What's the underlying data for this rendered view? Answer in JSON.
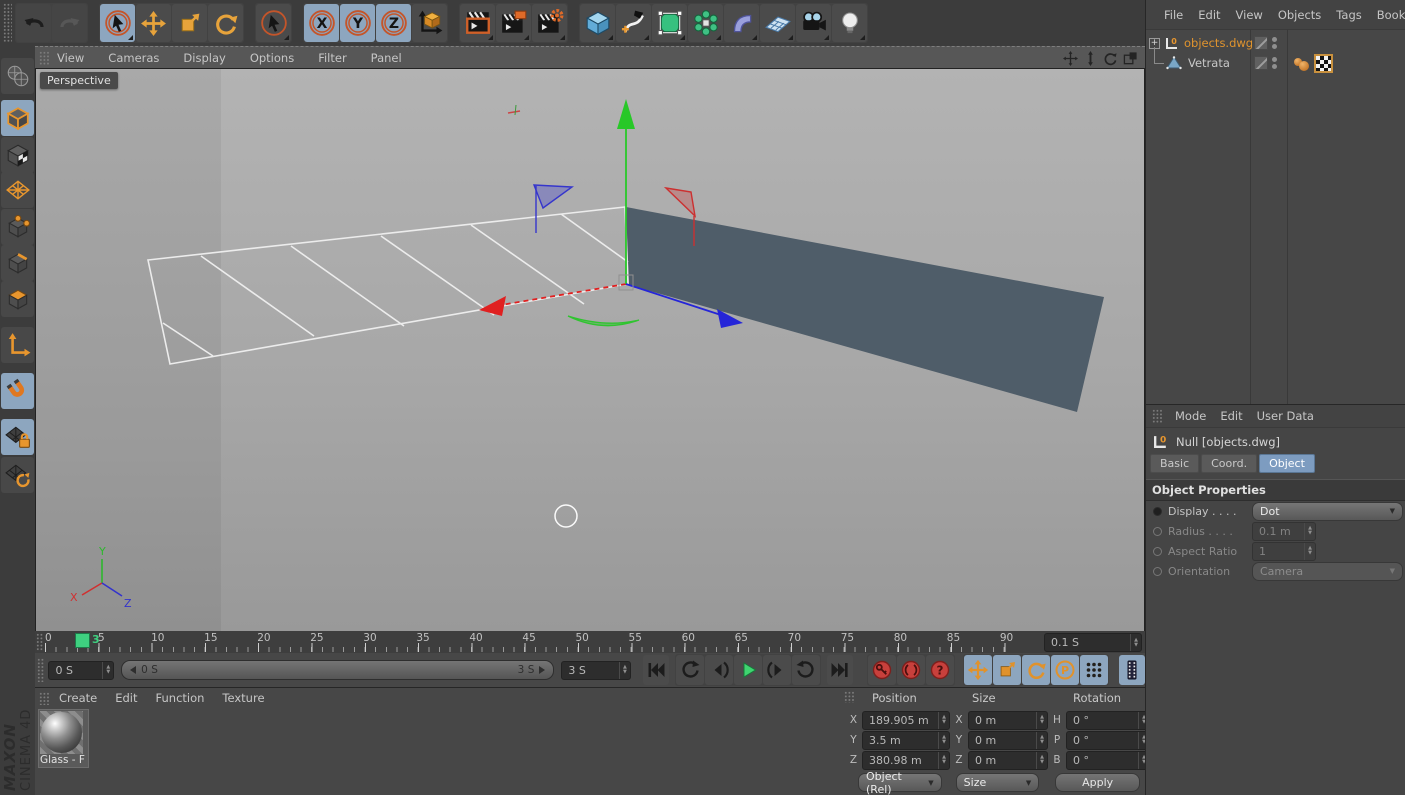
{
  "glyphs": {
    "expand": "+",
    "null_zero": "0",
    "record_help": "?",
    "parameter": "P"
  },
  "toolbar": {
    "lock_labels": [
      "X",
      "Y",
      "Z"
    ]
  },
  "viewport": {
    "menu": [
      "View",
      "Cameras",
      "Display",
      "Options",
      "Filter",
      "Panel"
    ],
    "camera_label": "Perspective",
    "axis": {
      "x": "X",
      "y": "Y",
      "z": "Z"
    }
  },
  "object_manager": {
    "menu": [
      "File",
      "Edit",
      "View",
      "Objects",
      "Tags",
      "Bookma"
    ],
    "objects": [
      {
        "name": "objects.dwg"
      },
      {
        "name": "Vetrata"
      }
    ]
  },
  "attribute_manager": {
    "menu": [
      "Mode",
      "Edit",
      "User Data"
    ],
    "title": "Null [objects.dwg]",
    "tabs": [
      "Basic",
      "Coord.",
      "Object"
    ],
    "active_tab": "Object",
    "section": "Object Properties",
    "fields": {
      "display_label": "Display . . . .",
      "display_value": "Dot",
      "radius_label": "Radius . . . .",
      "radius_value": "0.1 m",
      "aspect_label": "Aspect Ratio",
      "aspect_value": "1",
      "orientation_label": "Orientation",
      "orientation_value": "Camera"
    }
  },
  "timeline": {
    "ticks": [
      "0",
      "5",
      "10",
      "15",
      "20",
      "25",
      "30",
      "35",
      "40",
      "45",
      "50",
      "55",
      "60",
      "65",
      "70",
      "75",
      "80",
      "85",
      "90"
    ],
    "playhead": "3",
    "rate": "0.1 S"
  },
  "transport": {
    "start": "0 S",
    "range_start": "0 S",
    "range_end": "3 S",
    "end": "3 S"
  },
  "materials": {
    "menu": [
      "Create",
      "Edit",
      "Function",
      "Texture"
    ],
    "items": [
      {
        "name": "Glass - F"
      }
    ]
  },
  "coords": {
    "headers": [
      "Position",
      "Size",
      "Rotation"
    ],
    "rows": [
      {
        "pl": "X",
        "pv": "189.905 m",
        "sl": "X",
        "sv": "0 m",
        "rl": "H",
        "rv": "0 °"
      },
      {
        "pl": "Y",
        "pv": "3.5 m",
        "sl": "Y",
        "sv": "0 m",
        "rl": "P",
        "rv": "0 °"
      },
      {
        "pl": "Z",
        "pv": "380.98 m",
        "sl": "Z",
        "sv": "0 m",
        "rl": "B",
        "rv": "0 °"
      }
    ],
    "mode": "Object (Rel)",
    "size_mode": "Size",
    "apply": "Apply"
  },
  "branding": {
    "line1": "MAXON",
    "line2": "CINEMA 4D"
  },
  "colors": {
    "accent_orange": "#e8962e",
    "highlight_blue": "#8da6bf",
    "axis_red": "#e02020",
    "axis_green": "#28c828",
    "axis_blue": "#2525d8",
    "playhead_green": "#3ed180",
    "record_red": "#c8403c",
    "wall": "#4f5d69"
  }
}
